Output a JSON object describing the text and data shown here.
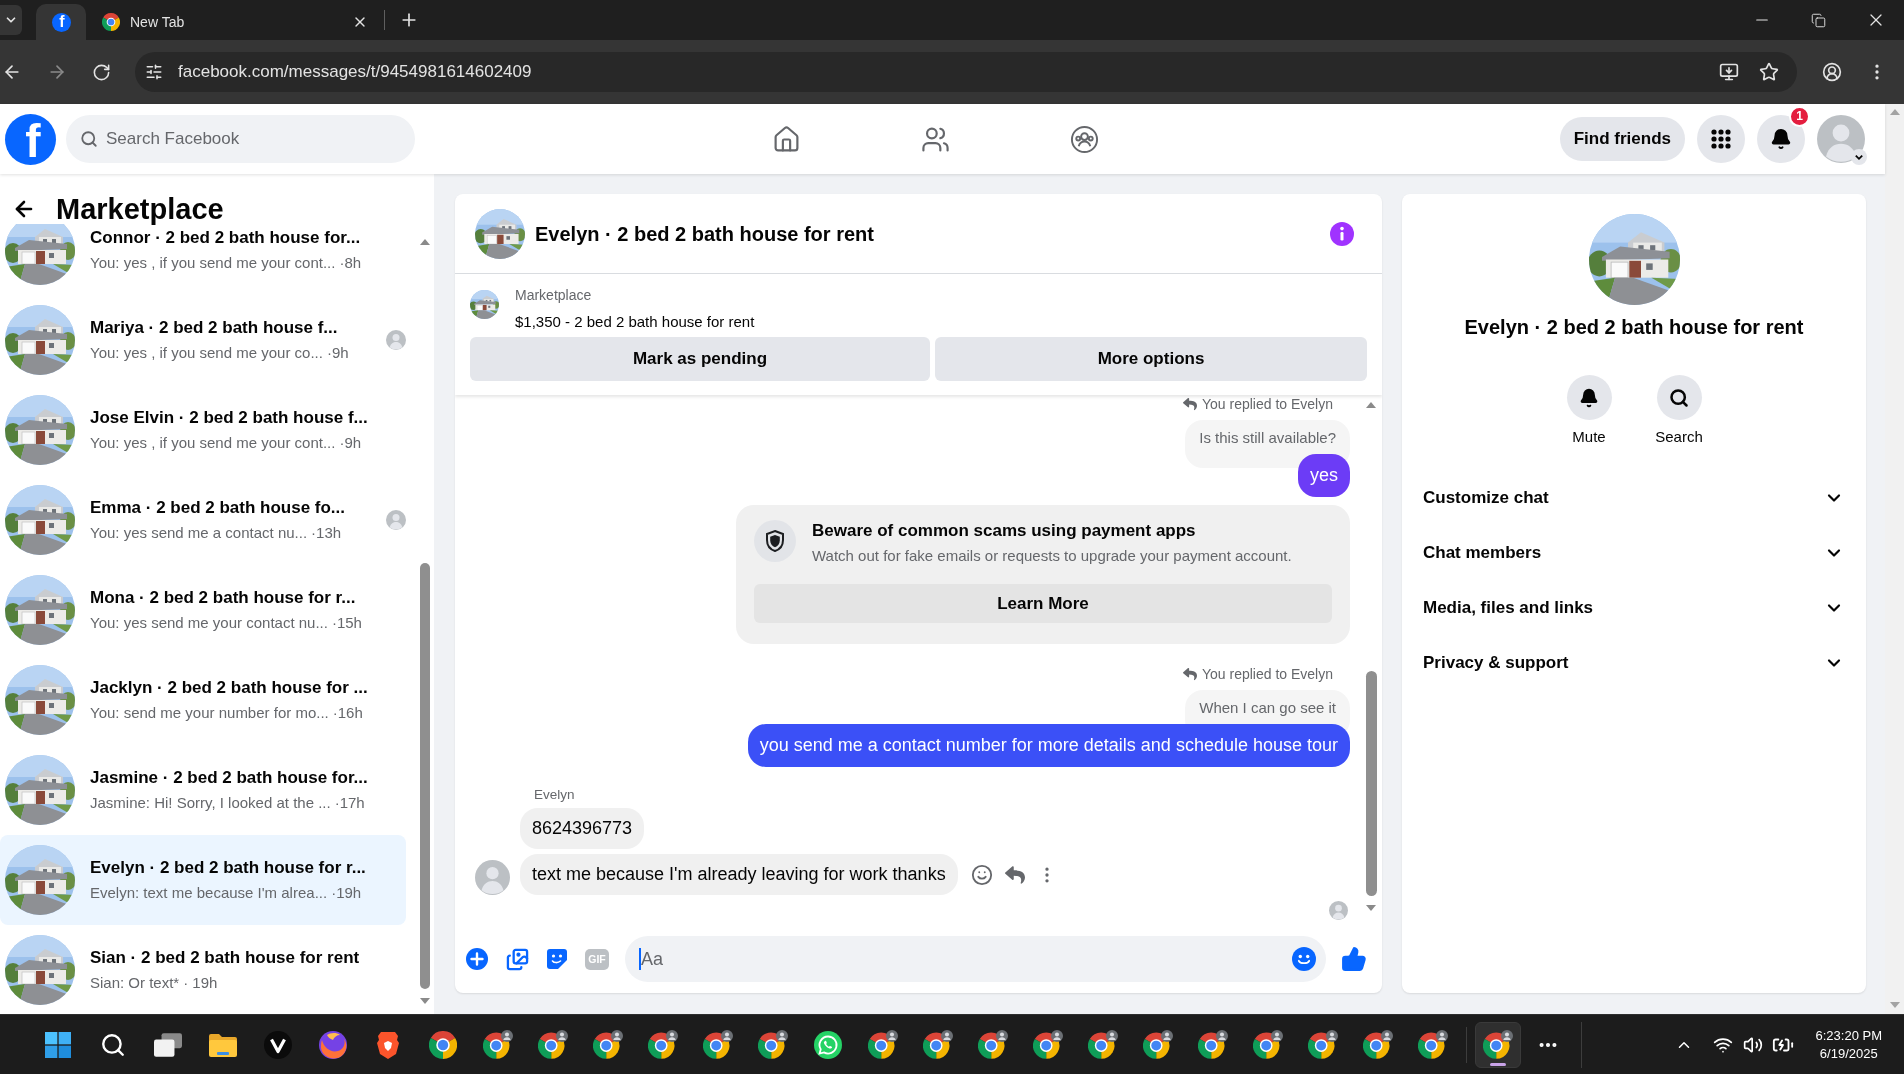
{
  "browser": {
    "tabs": [
      {
        "kind": "pinned",
        "favicon_text": "f",
        "selected": true
      },
      {
        "kind": "page",
        "title": "New Tab",
        "selected": false
      }
    ],
    "url": "facebook.com/messages/t/9454981614602409"
  },
  "header": {
    "logo": "f",
    "search": {
      "placeholder": "Search Facebook"
    },
    "find_friends": "Find friends",
    "notification_count": "1"
  },
  "sidebar": {
    "title": "Marketplace",
    "conversations": [
      {
        "name": "Connor · 2 bed 2 bath house for...",
        "preview": "You: yes , if you send me your cont...",
        "time": "·8h",
        "seen_by": false,
        "selected": false
      },
      {
        "name": "Mariya · 2 bed 2 bath house f...",
        "preview": "You: yes , if you send me your co...",
        "time": "·9h",
        "seen_by": true,
        "selected": false
      },
      {
        "name": "Jose Elvin · 2 bed 2 bath house f...",
        "preview": "You: yes , if you send me your cont...",
        "time": "·9h",
        "seen_by": false,
        "selected": false
      },
      {
        "name": "Emma · 2 bed 2 bath house fo...",
        "preview": "You: yes send me a contact nu...",
        "time": "·13h",
        "seen_by": true,
        "selected": false
      },
      {
        "name": "Mona · 2 bed 2 bath house for r...",
        "preview": "You: yes send me your contact nu...",
        "time": "·15h",
        "seen_by": false,
        "selected": false
      },
      {
        "name": "Jacklyn · 2 bed 2 bath house for ...",
        "preview": "You: send me your number for mo...",
        "time": "·16h",
        "seen_by": false,
        "selected": false
      },
      {
        "name": "Jasmine · 2 bed 2 bath house for...",
        "preview": "Jasmine: Hi! Sorry, I looked at the ...",
        "time": "·17h",
        "seen_by": false,
        "selected": false
      },
      {
        "name": "Evelyn · 2 bed 2 bath house for r...",
        "preview": "Evelyn: text me because I'm alrea...",
        "time": "·19h",
        "seen_by": false,
        "selected": true
      },
      {
        "name": "Sian · 2 bed 2 bath house for rent",
        "preview": "Sian: Or text*",
        "time": "· 19h",
        "seen_by": false,
        "selected": false
      }
    ]
  },
  "chat": {
    "title": "Evelyn · 2 bed 2 bath house for rent",
    "listing": {
      "label": "Marketplace",
      "text": "$1,350 - 2 bed 2 bath house for rent"
    },
    "actions": [
      "Mark as pending",
      "More options"
    ],
    "messages": [
      {
        "kind": "reply_note",
        "text": "You replied to Evelyn"
      },
      {
        "kind": "quote",
        "text": "Is this still available?"
      },
      {
        "kind": "sent",
        "text": "yes",
        "color": "#6c3cf6"
      },
      {
        "kind": "notice",
        "title": "Beware of common scams using payment apps",
        "text": "Watch out for fake emails or requests to upgrade your payment account.",
        "button": "Learn More"
      },
      {
        "kind": "reply_note",
        "text": "You replied to Evelyn"
      },
      {
        "kind": "quote",
        "text": "When I can go see it"
      },
      {
        "kind": "sent",
        "text": "you send me a contact number for more details and schedule house tour",
        "color": "#3b50f7"
      },
      {
        "kind": "sender",
        "text": "Evelyn"
      },
      {
        "kind": "received",
        "text": "8624396773",
        "avatar": false,
        "hovered": false
      },
      {
        "kind": "received",
        "text": "text me because I'm already leaving for work thanks",
        "avatar": true,
        "hovered": true
      },
      {
        "kind": "seen"
      }
    ],
    "composer": {
      "gif": "GIF",
      "placeholder": "Aa",
      "focused": true
    }
  },
  "details": {
    "title": "Evelyn · 2 bed 2 bath house for rent",
    "actions": [
      {
        "kind": "mute",
        "label": "Mute"
      },
      {
        "kind": "search",
        "label": "Search"
      }
    ],
    "sections": [
      {
        "label": "Customize chat",
        "expanded": false
      },
      {
        "label": "Chat members",
        "expanded": false
      },
      {
        "label": "Media, files and links",
        "expanded": false
      },
      {
        "label": "Privacy & support",
        "expanded": false
      }
    ]
  },
  "taskbar": {
    "apps": [
      {
        "kind": "start",
        "selected": false
      },
      {
        "kind": "search",
        "selected": false
      },
      {
        "kind": "task_view",
        "selected": false
      },
      {
        "kind": "files",
        "selected": false
      },
      {
        "kind": "v_browser",
        "selected": false
      },
      {
        "kind": "fox_browser",
        "selected": false
      },
      {
        "kind": "lion_browser",
        "selected": false
      },
      {
        "kind": "browser",
        "selected": false
      },
      {
        "kind": "browser_profile",
        "selected": false
      },
      {
        "kind": "browser_profile",
        "selected": false
      },
      {
        "kind": "browser_profile",
        "selected": false
      },
      {
        "kind": "browser_profile",
        "selected": false
      },
      {
        "kind": "browser_profile",
        "selected": false
      },
      {
        "kind": "browser_profile",
        "selected": false
      },
      {
        "kind": "chat",
        "selected": false
      },
      {
        "kind": "browser_profile",
        "selected": false
      },
      {
        "kind": "browser_profile",
        "selected": false
      },
      {
        "kind": "browser_profile",
        "selected": false
      },
      {
        "kind": "browser_profile",
        "selected": false
      },
      {
        "kind": "browser_profile",
        "selected": false
      },
      {
        "kind": "browser_profile",
        "selected": false
      },
      {
        "kind": "browser_profile",
        "selected": false
      },
      {
        "kind": "browser_profile",
        "selected": false
      },
      {
        "kind": "browser_profile",
        "selected": false
      },
      {
        "kind": "browser_profile",
        "selected": false
      },
      {
        "kind": "browser_profile",
        "selected": false
      },
      {
        "kind": "divider"
      },
      {
        "kind": "browser_profile",
        "selected": true
      },
      {
        "kind": "more",
        "selected": false
      }
    ],
    "clock": {
      "time": "6:23:20 PM",
      "date": "6/19/2025"
    }
  }
}
